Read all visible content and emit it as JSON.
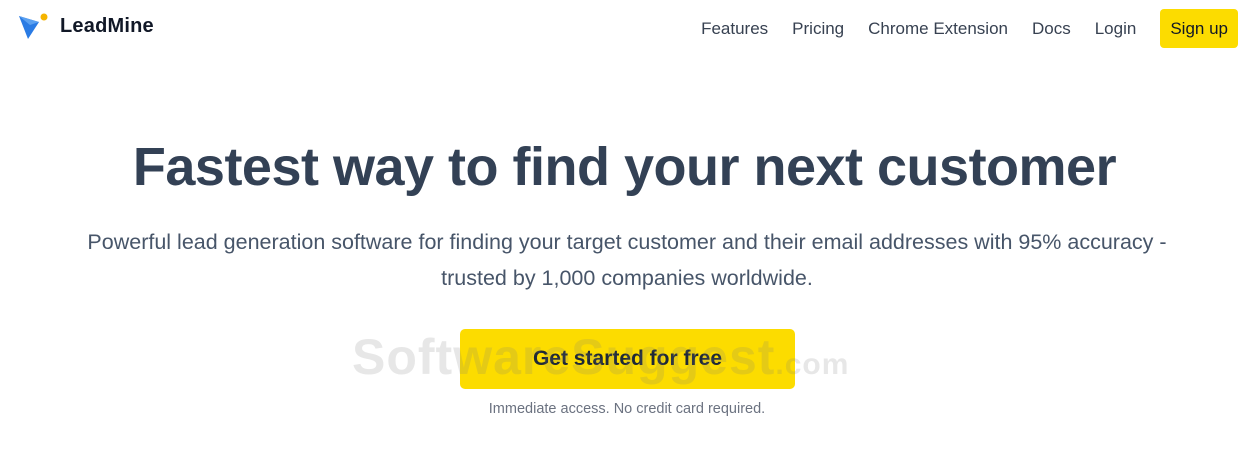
{
  "header": {
    "brand_name": "LeadMine",
    "nav": {
      "features": "Features",
      "pricing": "Pricing",
      "chrome_extension": "Chrome Extension",
      "docs": "Docs",
      "login": "Login",
      "signup": "Sign up"
    }
  },
  "hero": {
    "title": "Fastest way to find your next customer",
    "subtitle": "Powerful lead generation software for finding your target customer and their email addresses with 95% accuracy - trusted by 1,000 companies worldwide.",
    "cta_label": "Get started for free",
    "cta_note": "Immediate access. No credit card required."
  },
  "watermark": {
    "main": "SoftwareSuggest",
    "suffix": ".com"
  },
  "colors": {
    "accent": "#fcdc00",
    "logo_blue": "#2a7be4",
    "logo_dot": "#f5b400",
    "heading": "#334155"
  },
  "icons": {
    "logo": "leadmine-logo-icon"
  }
}
